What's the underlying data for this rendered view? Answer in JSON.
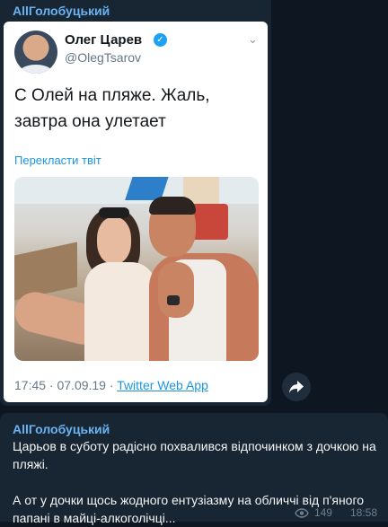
{
  "post1": {
    "channel": "AllГолобуцький",
    "tweet": {
      "author_name": "Олег Царев",
      "handle": "@OlegTsarov",
      "text": "С Олей на пляже. Жаль, завтра она улетает",
      "translate_label": "Перекласти твіт",
      "time": "17:45 · 07.09.19 · ",
      "source": "Twitter Web App",
      "verified_icon": "verified-checkmark-icon",
      "menu_icon": "chevron-down-icon"
    },
    "share_icon": "share-arrow-icon"
  },
  "post2": {
    "author": "AllГолобуцький",
    "text": "Царьов в суботу радісно похвалився відпочинком з дочкою на пляжі.\n\nА от у дочки щось жодного ентузіазму на обличчі від п'яного папані в майці-алкоголічці...",
    "views": "149",
    "time": "18:58",
    "views_icon": "eye-icon"
  },
  "colors": {
    "background": "#0e1621",
    "bubble": "#182533",
    "accent": "#6ab3f3",
    "twitter_link": "#1b95e0"
  }
}
